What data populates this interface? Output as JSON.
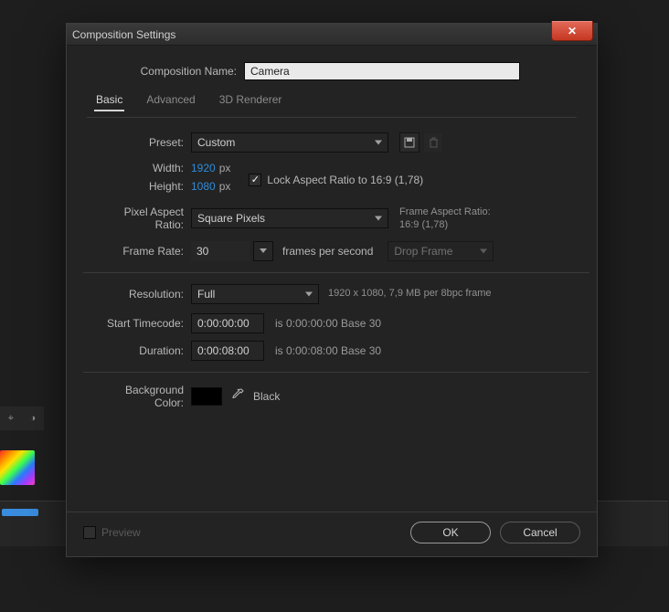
{
  "dialog": {
    "title": "Composition Settings",
    "name_label": "Composition Name:",
    "name_value": "Camera",
    "tabs": {
      "basic": "Basic",
      "advanced": "Advanced",
      "renderer": "3D Renderer"
    },
    "preset_label": "Preset:",
    "preset_value": "Custom",
    "width_label": "Width:",
    "width_value": "1920",
    "height_label": "Height:",
    "height_value": "1080",
    "px": "px",
    "lock_label": "Lock Aspect Ratio to 16:9 (1,78)",
    "par_label": "Pixel Aspect Ratio:",
    "par_value": "Square Pixels",
    "frame_ar_label": "Frame Aspect Ratio:",
    "frame_ar_value": "16:9 (1,78)",
    "framerate_label": "Frame Rate:",
    "framerate_value": "30",
    "fps_text": "frames per second",
    "drop_text": "Drop Frame",
    "resolution_label": "Resolution:",
    "resolution_value": "Full",
    "resolution_note": "1920 x 1080, 7,9 MB per 8bpc frame",
    "start_tc_label": "Start Timecode:",
    "start_tc_value": "0:00:00:00",
    "start_tc_note": "is 0:00:00:00  Base 30",
    "duration_label": "Duration:",
    "duration_value": "0:00:08:00",
    "duration_note": "is 0:00:08:00  Base 30",
    "bg_label": "Background Color:",
    "bg_name": "Black",
    "preview_label": "Preview",
    "ok": "OK",
    "cancel": "Cancel"
  }
}
